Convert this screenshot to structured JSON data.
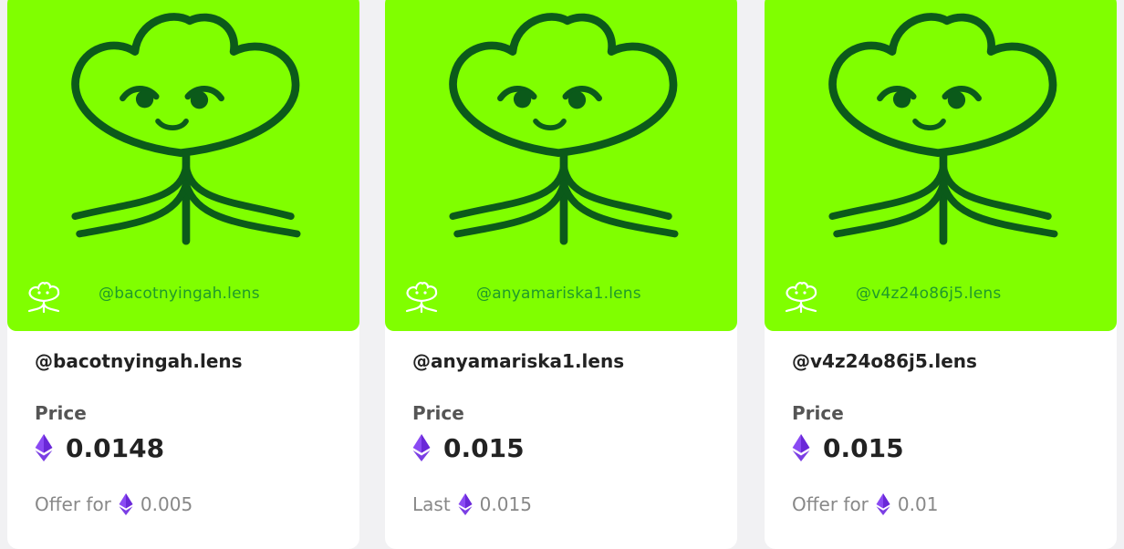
{
  "cards": [
    {
      "art_handle": "@bacotnyingah.lens",
      "handle": "@bacotnyingah.lens",
      "price_label": "Price",
      "price": "0.0148",
      "sub_label": "Offer for",
      "sub_value": "0.005"
    },
    {
      "art_handle": "@anyamariska1.lens",
      "handle": "@anyamariska1.lens",
      "price_label": "Price",
      "price": "0.015",
      "sub_label": "Last",
      "sub_value": "0.015"
    },
    {
      "art_handle": "@v4z24o86j5.lens",
      "handle": "@v4z24o86j5.lens",
      "price_label": "Price",
      "price": "0.015",
      "sub_label": "Offer for",
      "sub_value": "0.01"
    }
  ],
  "colors": {
    "art_background": "#80ff00",
    "mascot_stroke": "#0b5a1a",
    "eth_icon": "#7b3fe4"
  },
  "icons": [
    "flower-mascot-icon",
    "lens-logo-icon",
    "eth-icon"
  ]
}
